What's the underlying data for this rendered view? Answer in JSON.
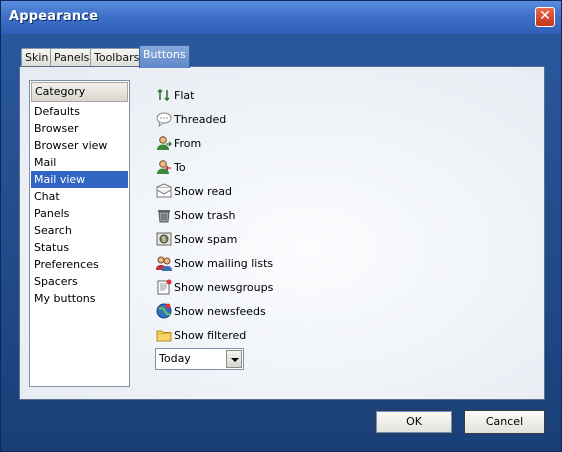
{
  "window": {
    "title": "Appearance",
    "close_label": "✕"
  },
  "tabs": [
    {
      "label": "Skin",
      "active": false
    },
    {
      "label": "Panels",
      "active": false
    },
    {
      "label": "Toolbars",
      "active": false
    },
    {
      "label": "Buttons",
      "active": true
    }
  ],
  "category": {
    "header": "Category",
    "items": [
      "Defaults",
      "Browser",
      "Browser view",
      "Mail",
      "Mail view",
      "Chat",
      "Panels",
      "Search",
      "Status",
      "Preferences",
      "Spacers",
      "My buttons"
    ],
    "selected": "Mail view"
  },
  "buttons": [
    {
      "label": "Flat",
      "icon": "flat-icon"
    },
    {
      "label": "Threaded",
      "icon": "threaded-icon"
    },
    {
      "label": "From",
      "icon": "from-icon"
    },
    {
      "label": "To",
      "icon": "to-icon"
    },
    {
      "label": "Show read",
      "icon": "show-read-icon"
    },
    {
      "label": "Show trash",
      "icon": "trash-icon"
    },
    {
      "label": "Show spam",
      "icon": "spam-icon"
    },
    {
      "label": "Show mailing lists",
      "icon": "mailing-lists-icon"
    },
    {
      "label": "Show newsgroups",
      "icon": "newsgroups-icon"
    },
    {
      "label": "Show newsfeeds",
      "icon": "newsfeeds-icon"
    },
    {
      "label": "Show filtered",
      "icon": "folder-icon"
    }
  ],
  "dropdown": {
    "value": "Today"
  },
  "footer": {
    "ok_label": "OK",
    "cancel_label": "Cancel"
  },
  "colors": {
    "accent": "#3165c3",
    "title_bar": "#3f70c8",
    "close": "#d44a2f"
  }
}
